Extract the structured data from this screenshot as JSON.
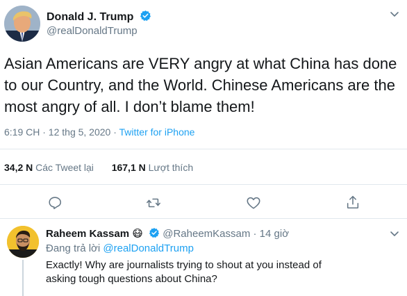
{
  "tweet": {
    "author_name": "Donald J. Trump",
    "author_handle": "@realDonaldTrump",
    "text": "Asian Americans are VERY angry at what China has done to our Country, and the World. Chinese Americans are the most angry of all. I don’t blame them!",
    "time": "6:19 CH · 12 thg 5, 2020 · ",
    "source": "Twitter for iPhone",
    "retweets_count": "34,2 N",
    "retweets_label": "Các Tweet lại",
    "likes_count": "167,1 N",
    "likes_label": "Lượt thích",
    "actions": [
      "reply-icon",
      "retweet-icon",
      "like-icon",
      "share-icon"
    ]
  },
  "reply": {
    "author_name": "Raheem Kassam",
    "emoji": "😷",
    "author_handle": "@RaheemKassam",
    "time": "· 14 giờ",
    "replying_label": "Đang trả lời",
    "replying_to": "@realDonaldTrump",
    "text": "Exactly! Why are journalists trying to shout at you instead of asking tough questions about China?"
  },
  "colors": {
    "accent": "#1da1f2",
    "secondary_text": "#657786",
    "divider": "#e1e8ed"
  }
}
